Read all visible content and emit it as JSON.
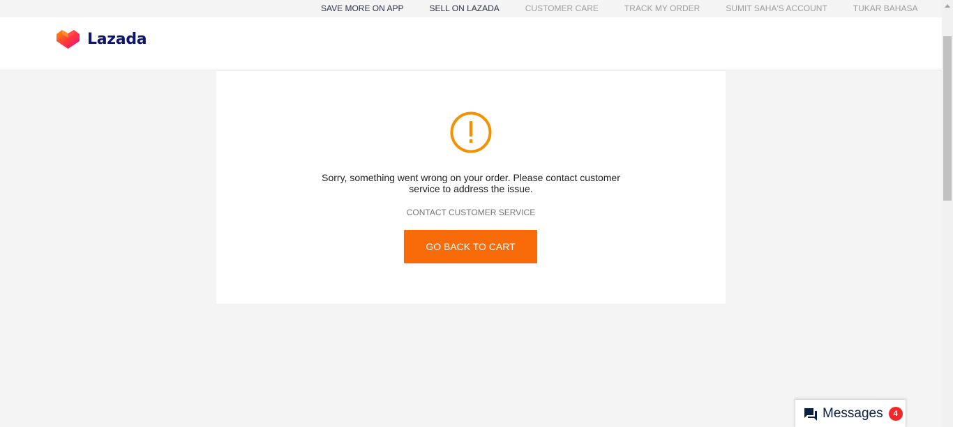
{
  "topbar": {
    "links": [
      {
        "label": "SAVE MORE ON APP"
      },
      {
        "label": "SELL ON LAZADA"
      },
      {
        "label": "CUSTOMER CARE"
      },
      {
        "label": "TRACK MY ORDER"
      },
      {
        "label": "SUMIT SAHA'S ACCOUNT"
      },
      {
        "label": "TUKAR BAHASA"
      }
    ]
  },
  "header": {
    "brand": "Lazada",
    "logo_icon": "lazada-heart-icon"
  },
  "error_card": {
    "icon": "warning-circle-icon",
    "message": "Sorry, something went wrong on your order. Please contact customer service to address the issue.",
    "contact_label": "CONTACT CUSTOMER SERVICE",
    "button_label": "GO BACK TO CART"
  },
  "messages": {
    "label": "Messages",
    "badge_count": "4",
    "icon": "chat-bubbles-icon"
  },
  "colors": {
    "accent": "#f96b09",
    "warning": "#f39200",
    "brand_text": "#0f146d",
    "badge": "#f1272a"
  }
}
